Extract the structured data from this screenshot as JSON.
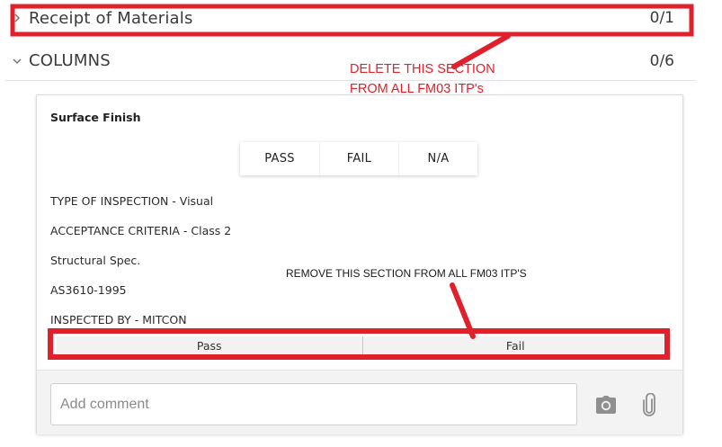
{
  "sections": [
    {
      "title": "Receipt of Materials",
      "count": "0/1",
      "expanded": false
    },
    {
      "title": "COLUMNS",
      "count": "0/6",
      "expanded": true
    }
  ],
  "card": {
    "title": "Surface Finish",
    "choices": [
      "PASS",
      "FAIL",
      "N/A"
    ],
    "details": [
      "TYPE OF INSPECTION - Visual",
      "ACCEPTANCE CRITERIA - Class 2",
      "Structural Spec.",
      "AS3610-1995",
      "INSPECTED BY - MITCON"
    ],
    "pass_fail": {
      "pass_label": "Pass",
      "fail_label": "Fail"
    },
    "comment": {
      "placeholder": "Add comment",
      "value": ""
    }
  },
  "annotations": {
    "delete_note": "DELETE THIS SECTION FROM ALL FM03 ITP's",
    "remove_note": "REMOVE THIS SECTION FROM ALL FM03 ITP'S",
    "color": "#e0202a"
  },
  "icons": [
    "chevron-right-icon",
    "chevron-down-icon",
    "camera-icon",
    "paperclip-icon"
  ]
}
